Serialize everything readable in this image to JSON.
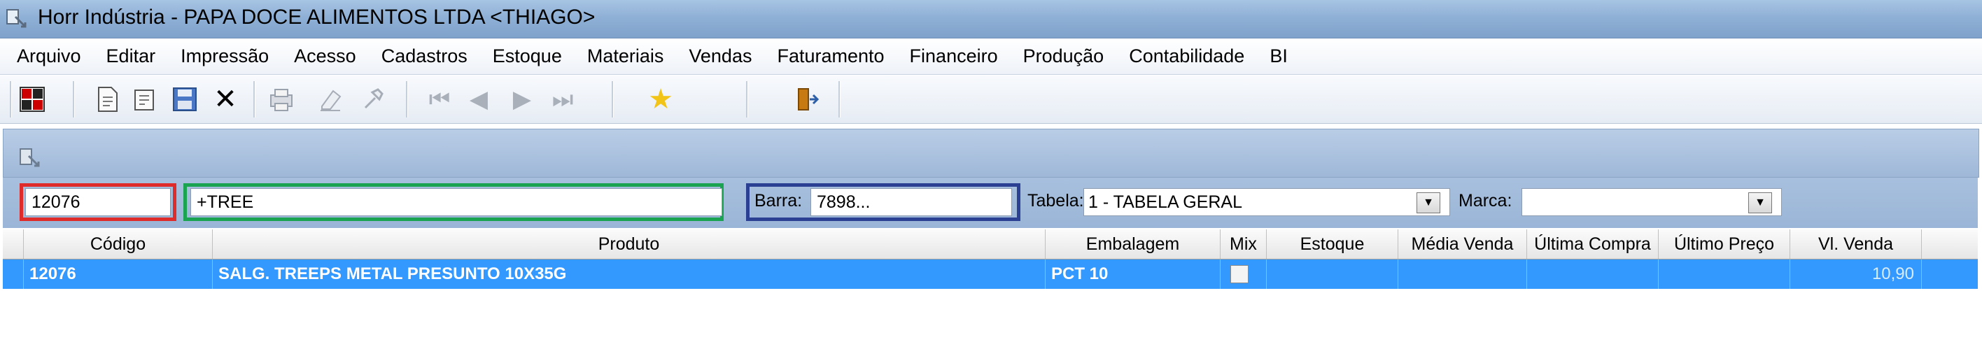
{
  "window": {
    "title": "Horr Indústria - PAPA DOCE ALIMENTOS LTDA <THIAGO>"
  },
  "menu": [
    "Arquivo",
    "Editar",
    "Impressão",
    "Acesso",
    "Cadastros",
    "Estoque",
    "Materiais",
    "Vendas",
    "Faturamento",
    "Financeiro",
    "Produção",
    "Contabilidade",
    "BI"
  ],
  "toolbar": {
    "icons": [
      "calculator-icon",
      "new-document-icon",
      "edit-document-icon",
      "save-icon",
      "delete-icon",
      "print-icon",
      "eraser-icon",
      "tools-icon",
      "first-record-icon",
      "previous-record-icon",
      "next-record-icon",
      "last-record-icon",
      "favorite-star-icon",
      "exit-door-icon"
    ]
  },
  "filters": {
    "codigo_value": "12076",
    "produto_value": "+TREE",
    "barra_label": "Barra:",
    "barra_value": "7898...",
    "tabela_label": "Tabela:",
    "tabela_value": "1 - TABELA GERAL",
    "marca_label": "Marca:",
    "marca_value": ""
  },
  "highlights": {
    "codigo_color": "#e02b2b",
    "produto_color": "#1aa350",
    "barra_color": "#2b3f93"
  },
  "grid": {
    "columns": [
      "Código",
      "Produto",
      "Embalagem",
      "Mix",
      "Estoque",
      "Média Venda",
      "Última Compra",
      "Último Preço",
      "Vl. Venda"
    ],
    "rows": [
      {
        "codigo": "12076",
        "produto": "SALG. TREEPS METAL PRESUNTO 10X35G",
        "embalagem": "PCT 10",
        "mix": false,
        "estoque": "",
        "media_venda": "",
        "ultima_compra": "",
        "ultimo_preco": "",
        "vl_venda": "10,90"
      }
    ],
    "selected_row_color": "#3399ff"
  }
}
